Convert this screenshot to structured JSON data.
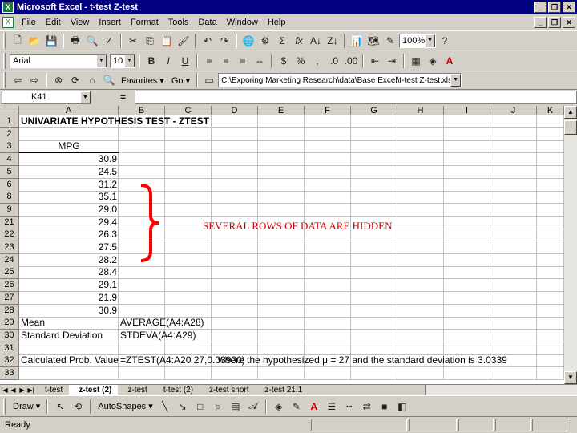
{
  "window": {
    "title": "Microsoft Excel - t-test Z-test"
  },
  "menu": [
    "File",
    "Edit",
    "View",
    "Insert",
    "Format",
    "Tools",
    "Data",
    "Window",
    "Help"
  ],
  "toolbar": {
    "zoom": "100%",
    "font": "Arial",
    "font_size": "10"
  },
  "web": {
    "favorites": "Favorites",
    "go": "Go",
    "address": "C:\\Exporing Marketing Research\\data\\Base Excel\\t-test Z-test.xls"
  },
  "formula": {
    "namebox": "K41",
    "eq": "="
  },
  "columns": [
    "A",
    "B",
    "C",
    "D",
    "E",
    "F",
    "G",
    "H",
    "I",
    "J",
    "K"
  ],
  "rows": [
    {
      "n": "1",
      "a": "UNIVARIATE HYPOTHESIS TEST - ZTEST",
      "b": "",
      "e": "",
      "type": "title"
    },
    {
      "n": "2",
      "a": "",
      "b": "",
      "e": "",
      "type": "blank"
    },
    {
      "n": "3",
      "a": "MPG",
      "b": "",
      "e": "",
      "type": "header"
    },
    {
      "n": "4",
      "a": "30.9",
      "b": "",
      "e": "",
      "type": "num"
    },
    {
      "n": "5",
      "a": "24.5",
      "b": "",
      "e": "",
      "type": "num"
    },
    {
      "n": "6",
      "a": "31.2",
      "b": "",
      "e": "",
      "type": "num"
    },
    {
      "n": "8",
      "a": "35.1",
      "b": "",
      "e": "",
      "type": "num"
    },
    {
      "n": "9",
      "a": "29.0",
      "b": "",
      "e": "",
      "type": "num"
    },
    {
      "n": "21",
      "a": "29.4",
      "b": "",
      "e": "",
      "type": "num"
    },
    {
      "n": "22",
      "a": "26.3",
      "b": "",
      "e": "",
      "type": "num"
    },
    {
      "n": "23",
      "a": "27.5",
      "b": "",
      "e": "",
      "type": "num"
    },
    {
      "n": "24",
      "a": "28.2",
      "b": "",
      "e": "",
      "type": "num"
    },
    {
      "n": "25",
      "a": "28.4",
      "b": "",
      "e": "",
      "type": "num"
    },
    {
      "n": "26",
      "a": "29.1",
      "b": "",
      "e": "",
      "type": "num"
    },
    {
      "n": "27",
      "a": "21.9",
      "b": "",
      "e": "",
      "type": "num"
    },
    {
      "n": "28",
      "a": "30.9",
      "b": "",
      "e": "",
      "type": "num"
    },
    {
      "n": "29",
      "a": "Mean",
      "b": "AVERAGE(A4:A28)",
      "e": "",
      "type": "formula"
    },
    {
      "n": "30",
      "a": "Standard Deviation",
      "b": "STDEVA(A4:A29)",
      "e": "",
      "type": "formula"
    },
    {
      "n": "31",
      "a": "",
      "b": "",
      "e": "",
      "type": "blank"
    },
    {
      "n": "32",
      "a": "Calculated Prob. Value",
      "b": "=ZTEST(A4:A20 27,0.03900)",
      "e": "where the hypothesized μ = 27 and the standard deviation is 3.0339",
      "type": "formula"
    },
    {
      "n": "33",
      "a": "",
      "b": "",
      "e": "",
      "type": "blank"
    }
  ],
  "annotation": "SEVERAL ROWS OF DATA ARE HIDDEN",
  "sheet_tabs": [
    "t-test",
    "z-test (2)",
    "z-test",
    "t-test (2)",
    "z-test short",
    "z-test 21.1"
  ],
  "active_tab": 1,
  "drawing": {
    "draw": "Draw",
    "autoshapes": "AutoShapes"
  },
  "status": {
    "text": "Ready"
  },
  "colors": {
    "title_bar": "#000080",
    "annotation": "#cc0000",
    "bracket": "#ff0000"
  }
}
